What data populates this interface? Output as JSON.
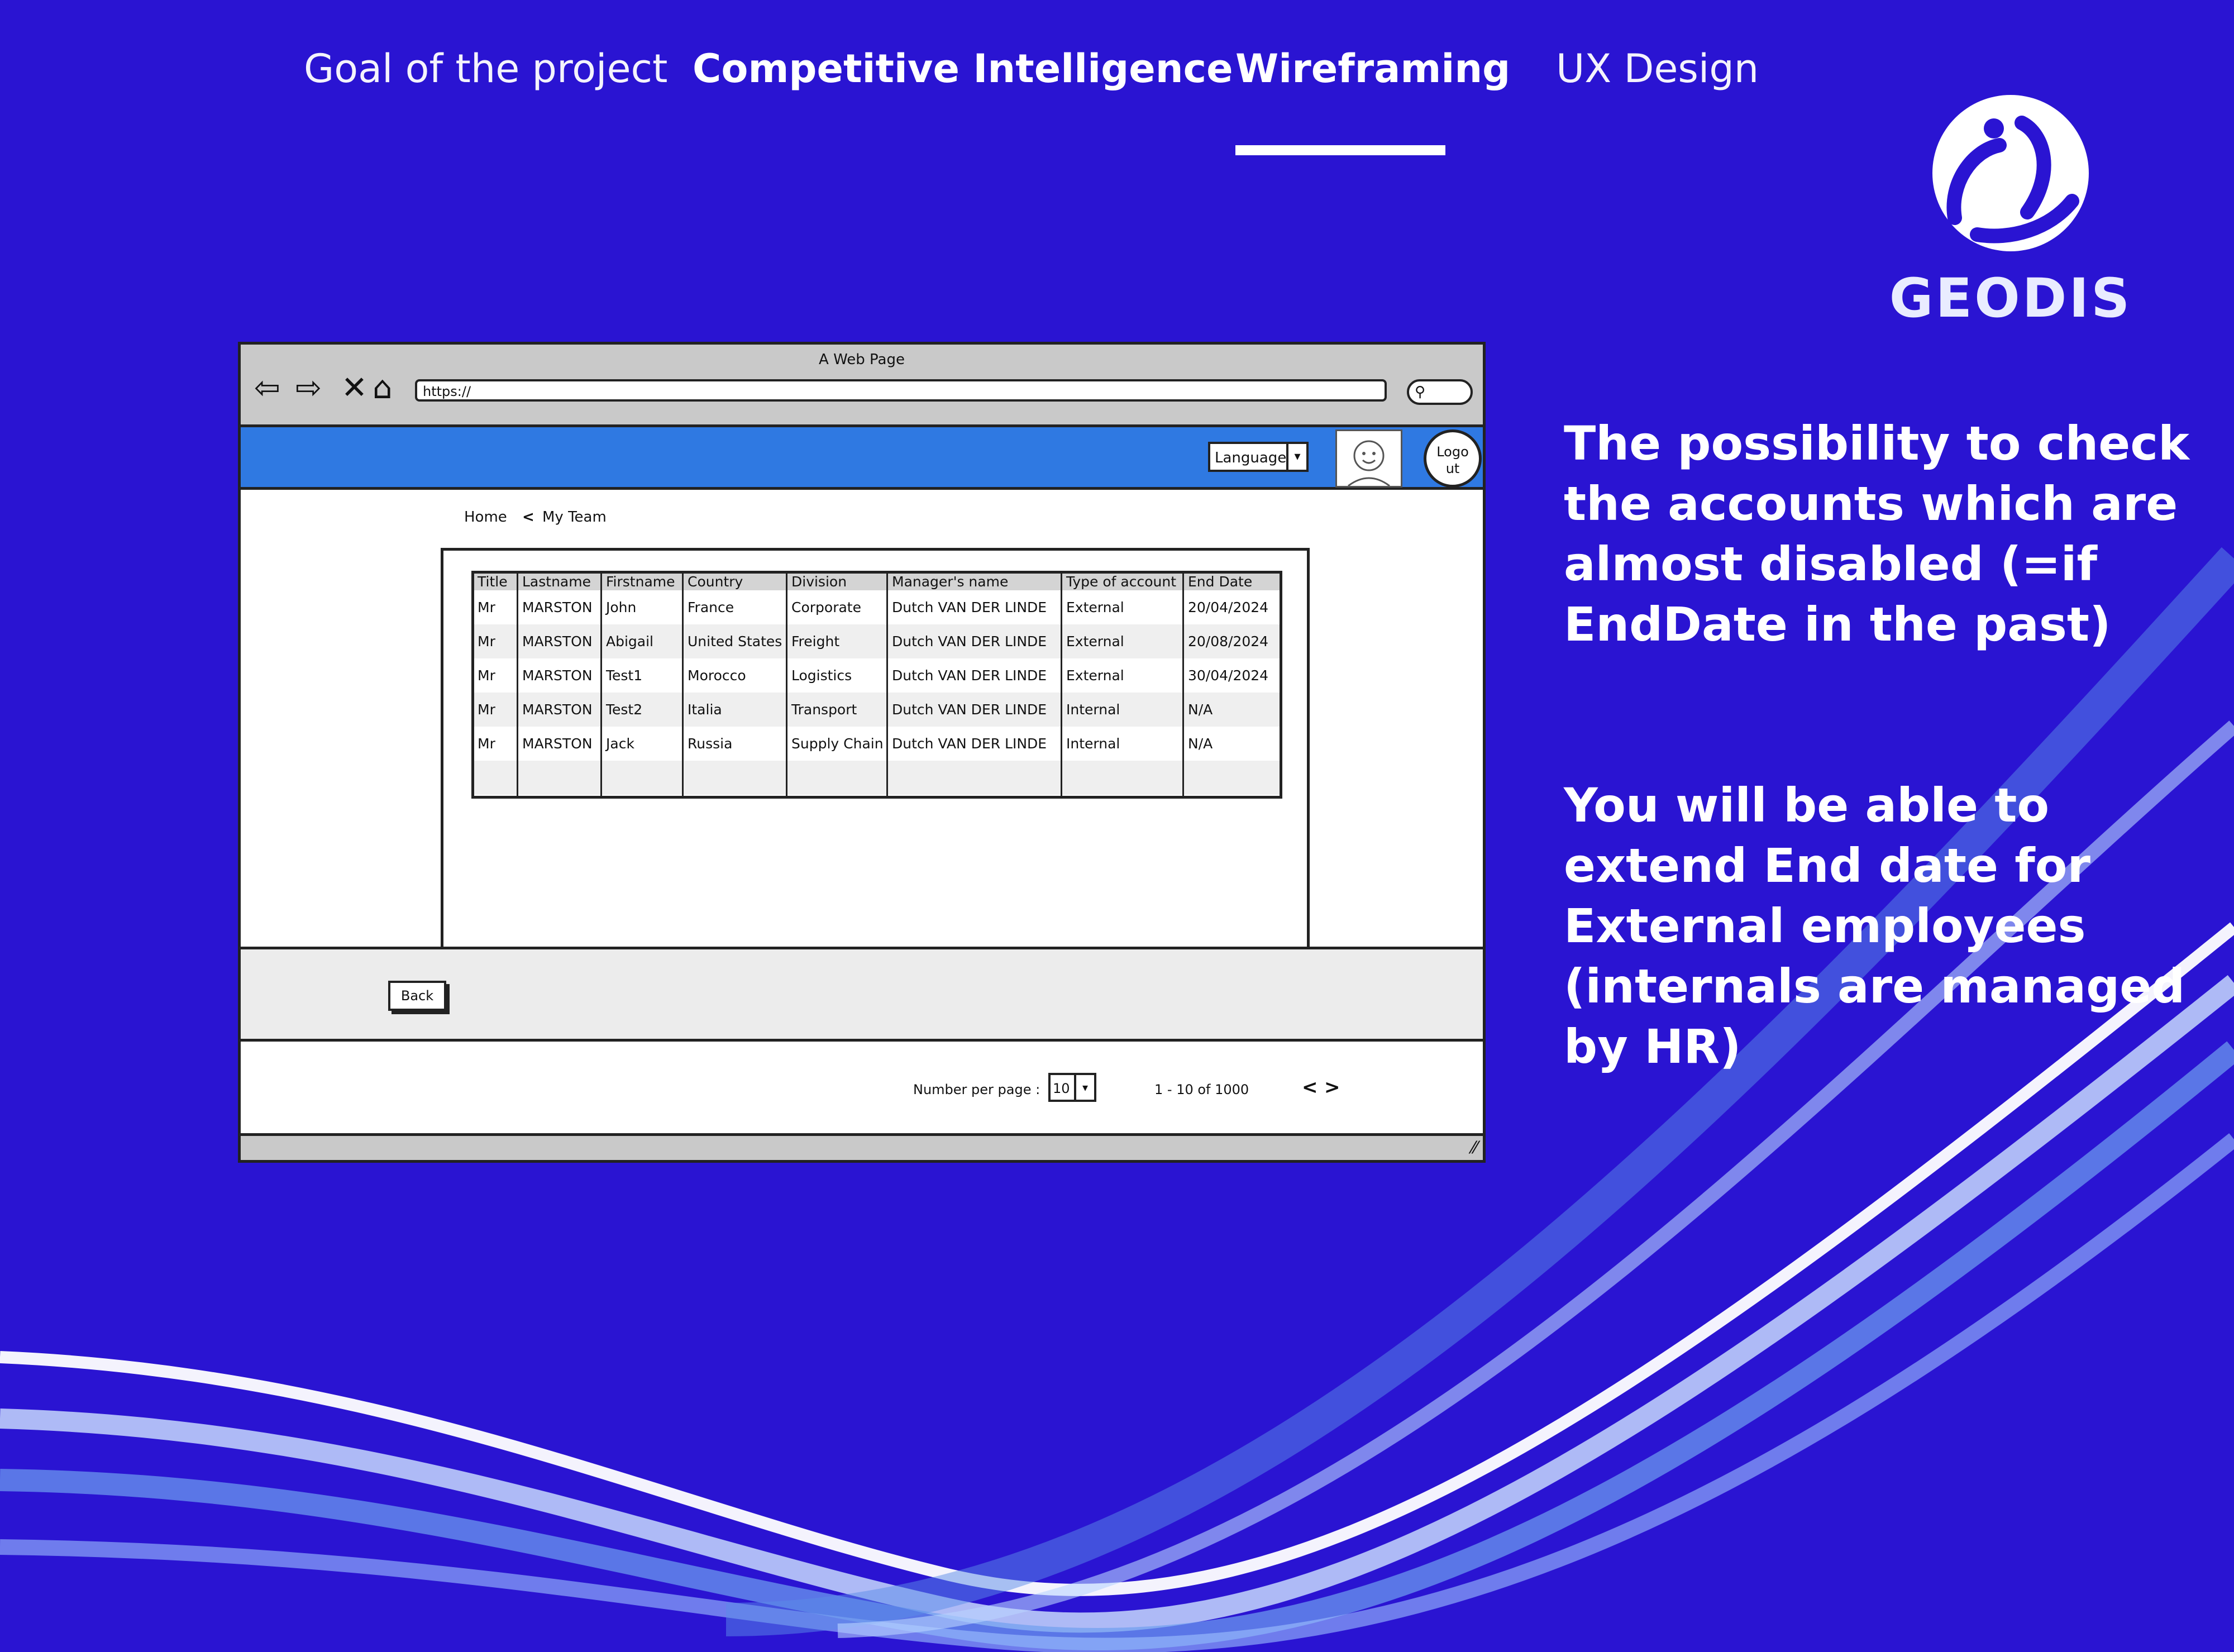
{
  "nav": {
    "items": [
      {
        "label": "Goal of the project"
      },
      {
        "label": "Competitive Intelligence"
      },
      {
        "label": "Wireframing",
        "active": true
      },
      {
        "label": "UX Design"
      }
    ]
  },
  "brand": {
    "name": "GEODIS",
    "icon": "geodis-logo-icon"
  },
  "side_text": {
    "paragraph_1": "The possibility to check the accounts which are almost disabled (=if EndDate in the past)",
    "paragraph_2": "You will be able to extend End date for External employees (internals are managed by HR)"
  },
  "wireframe": {
    "window_title": "A Web Page",
    "url": "https://",
    "icons": [
      "back-arrow-icon",
      "forward-arrow-icon",
      "close-icon",
      "home-icon",
      "search-icon",
      "user-avatar-icon"
    ],
    "language_label": "Language",
    "logout_label_1": "Logo",
    "logout_label_2": "ut",
    "breadcrumb": {
      "home": "Home",
      "sep": "<",
      "current": "My Team"
    },
    "table": {
      "columns": [
        "Title",
        "Lastname",
        "Firstname",
        "Country",
        "Division",
        "Manager's name",
        "Type of account",
        "End Date"
      ],
      "rows": [
        [
          "Mr",
          "MARSTON",
          "John",
          "France",
          "Corporate",
          "Dutch VAN DER LINDE",
          "External",
          "20/04/2024"
        ],
        [
          "Mr",
          "MARSTON",
          "Abigail",
          "United States",
          "Freight",
          "Dutch VAN DER LINDE",
          "External",
          "20/08/2024"
        ],
        [
          "Mr",
          "MARSTON",
          "Test1",
          "Morocco",
          "Logistics",
          "Dutch VAN DER LINDE",
          "External",
          "30/04/2024"
        ],
        [
          "Mr",
          "MARSTON",
          "Test2",
          "Italia",
          "Transport",
          "Dutch VAN DER LINDE",
          "Internal",
          "N/A"
        ],
        [
          "Mr",
          "MARSTON",
          "Jack",
          "Russia",
          "Supply Chain",
          "Dutch VAN DER LINDE",
          "Internal",
          "N/A"
        ]
      ]
    },
    "back_label": "Back",
    "pager": {
      "per_page_label": "Number per page :",
      "per_page_value": "10",
      "range_text": "1 - 10 of 1000",
      "prev": "<",
      "next": ">"
    }
  },
  "colors": {
    "background": "#2a14d2",
    "app_bar": "#2f79e2",
    "text": "#ffffff"
  }
}
